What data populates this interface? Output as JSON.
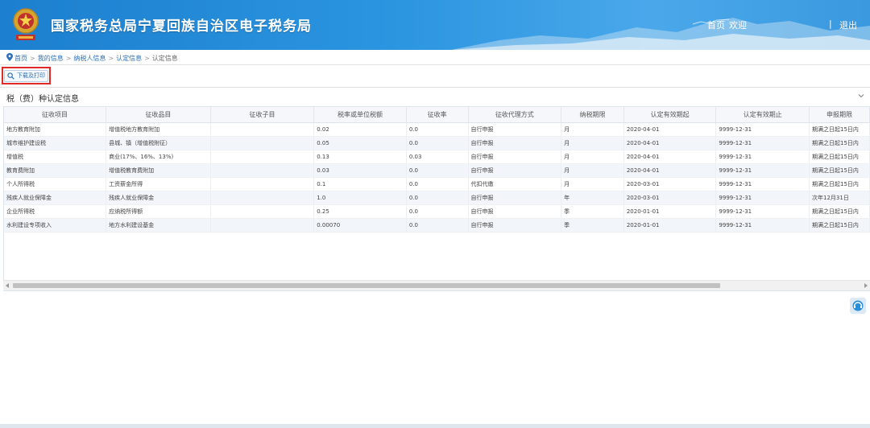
{
  "header": {
    "title": "国家税务总局宁夏回族自治区电子税务局",
    "links": {
      "home": "首页",
      "welcome": "欢迎",
      "separator": "|",
      "logout": "退出"
    },
    "brand_color": "#2b8fdc"
  },
  "breadcrumb": [
    "首页",
    "我的信息",
    "纳税人信息",
    "认定信息",
    "认定信息"
  ],
  "toolbar": {
    "download_print": "下载及打印"
  },
  "section": {
    "title": "税（费）种认定信息"
  },
  "table": {
    "columns": [
      "征收项目",
      "征收品目",
      "征收子目",
      "税率或单位税额",
      "征收率",
      "征收代理方式",
      "纳税期限",
      "认定有效期起",
      "认定有效期止",
      "申报期限"
    ],
    "rows": [
      [
        "地方教育附加",
        "增值税地方教育附加",
        "",
        "0.02",
        "0.0",
        "自行申报",
        "月",
        "2020-04-01",
        "9999-12-31",
        "期满之日起15日内"
      ],
      [
        "城市维护建设税",
        "县城、镇（增值税附征）",
        "",
        "0.05",
        "0.0",
        "自行申报",
        "月",
        "2020-04-01",
        "9999-12-31",
        "期满之日起15日内"
      ],
      [
        "增值税",
        "商业(17%、16%、13%)",
        "",
        "0.13",
        "0.03",
        "自行申报",
        "月",
        "2020-04-01",
        "9999-12-31",
        "期满之日起15日内"
      ],
      [
        "教育费附加",
        "增值税教育费附加",
        "",
        "0.03",
        "0.0",
        "自行申报",
        "月",
        "2020-04-01",
        "9999-12-31",
        "期满之日起15日内"
      ],
      [
        "个人所得税",
        "工资薪金所得",
        "",
        "0.1",
        "0.0",
        "代扣代缴",
        "月",
        "2020-03-01",
        "9999-12-31",
        "期满之日起15日内"
      ],
      [
        "残疾人就业保障金",
        "残疾人就业保障金",
        "",
        "1.0",
        "0.0",
        "自行申报",
        "年",
        "2020-03-01",
        "9999-12-31",
        "次年12月31日"
      ],
      [
        "企业所得税",
        "应纳税所得额",
        "",
        "0.25",
        "0.0",
        "自行申报",
        "季",
        "2020-01-01",
        "9999-12-31",
        "期满之日起15日内"
      ],
      [
        "水利建设专项收入",
        "地方水利建设基金",
        "",
        "0.00070",
        "0.0",
        "自行申报",
        "季",
        "2020-01-01",
        "9999-12-31",
        "期满之日起15日内"
      ]
    ]
  },
  "icons": {
    "emblem": "tax-emblem-icon",
    "pin": "location-pin-icon",
    "search": "search-icon",
    "collapse": "chevron-down-icon",
    "help": "customer-service-icon"
  },
  "colors": {
    "highlight": "#e02a2a",
    "link": "#2a6fb8",
    "row_alt": "#f2f6fb"
  }
}
